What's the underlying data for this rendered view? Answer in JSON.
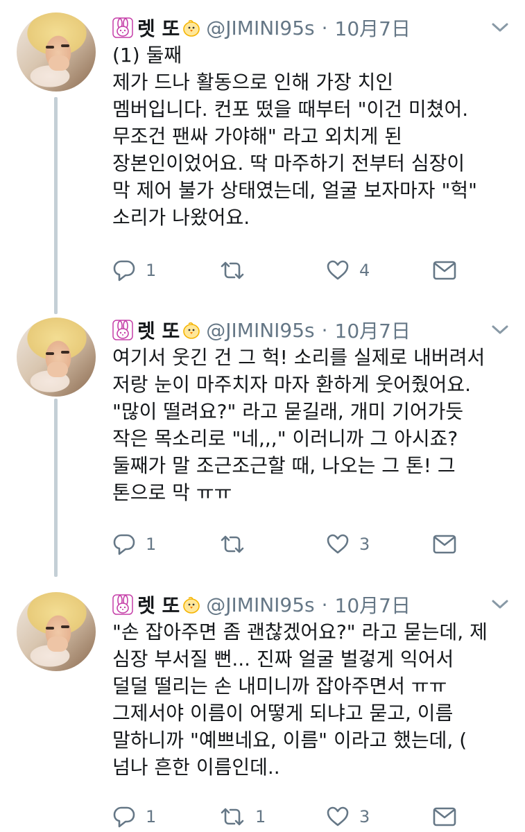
{
  "tweets": [
    {
      "display_name": "렛 또",
      "handle": "@JIMINI95s",
      "separator": "·",
      "date": "10月7日",
      "text": "(1) 둘째\n제가 드나 활동으로 인해 가장 치인\n멤버입니다. 컨포 떴을 때부터 \"이건 미쳤어.\n무조건 팬싸 가야해\" 라고 외치게 된\n장본인이었어요. 딱 마주하기 전부터 심장이\n막 제어 불가 상태였는데, 얼굴 보자마자 \"헉\"\n소리가 나왔어요.",
      "reply_count": "1",
      "retweet_count": "",
      "like_count": "4"
    },
    {
      "display_name": "렛 또",
      "handle": "@JIMINI95s",
      "separator": "·",
      "date": "10月7日",
      "text": "여기서 웃긴 건 그 헉! 소리를 실제로 내버려서\n저랑 눈이 마주치자 마자 환하게 웃어줬어요.\n\"많이 떨려요?\" 라고 묻길래, 개미 기어가듯\n작은 목소리로 \"네,,,\" 이러니까 그 아시죠?\n둘째가 말 조근조근할 때, 나오는 그 톤! 그\n톤으로 막 ㅠㅠ",
      "reply_count": "1",
      "retweet_count": "",
      "like_count": "3"
    },
    {
      "display_name": "렛 또",
      "handle": "@JIMINI95s",
      "separator": "·",
      "date": "10月7日",
      "text": "\"손 잡아주면 좀 괜찮겠어요?\" 라고 묻는데, 제\n심장 부서질 뻔... 진짜 얼굴 벌겋게 익어서\n덜덜 떨리는 손 내미니까 잡아주면서 ㅠㅠ\n그제서야 이름이 어떻게 되냐고 묻고, 이름\n말하니까 \"예쁘네요, 이름\" 이라고 했는데, (\n넘나 흔한 이름인데..",
      "reply_count": "1",
      "retweet_count": "1",
      "like_count": "3"
    }
  ],
  "icons": {
    "avatar": "profile-photo",
    "name_prefix": "rabbit-emoji",
    "name_suffix": "chick-emoji",
    "menu": "chevron-down-icon",
    "reply": "reply-icon",
    "retweet": "retweet-icon",
    "like": "heart-icon",
    "dm": "mail-icon"
  },
  "colors": {
    "text": "#14171a",
    "secondary": "#657786",
    "thread_line": "#c4cfd6",
    "rabbit": "#c53fa8",
    "chick": "#f5b400"
  }
}
